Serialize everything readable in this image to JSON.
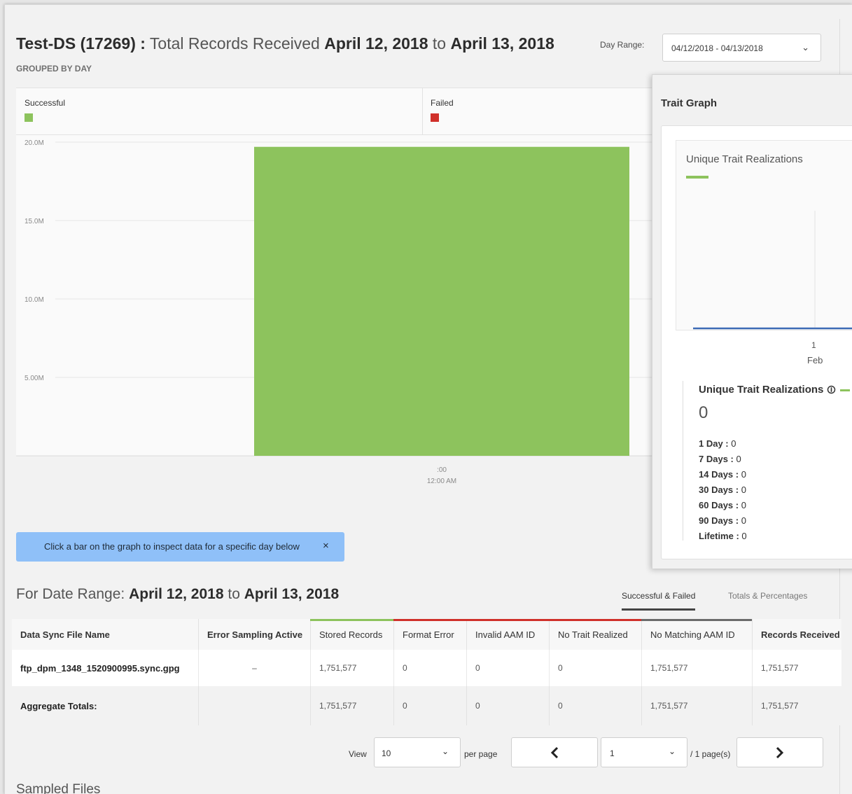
{
  "header": {
    "ds_name": "Test-DS (17269) :",
    "metric": "Total Records Received",
    "date_from": "April 12, 2018",
    "to": "to",
    "date_to": "April 13, 2018",
    "grouped": "GROUPED BY DAY",
    "day_range_label": "Day Range:",
    "day_range_value": "04/12/2018 - 04/13/2018"
  },
  "legend": {
    "successful": "Successful",
    "failed": "Failed"
  },
  "colors": {
    "successful": "#8dc35d",
    "failed": "#d0302a",
    "cta": "#8fc0f8",
    "gray_bar": "#6b6b6b",
    "trait_line": "#3d6bb5"
  },
  "chart_data": {
    "type": "bar",
    "title": "",
    "x_tick_top": ":00",
    "x_tick_bottom": "12:00 AM",
    "y_ticks": [
      "20.0M",
      "15.0M",
      "10.0M",
      "5.00M"
    ],
    "ylim": [
      0,
      20000000
    ],
    "series": [
      {
        "name": "Successful",
        "values": [
          19700000
        ]
      },
      {
        "name": "Failed",
        "values": [
          0
        ]
      }
    ],
    "grid": true
  },
  "cta": {
    "text": "Click a bar on the graph to inspect data for a specific day below",
    "close": "×"
  },
  "range": {
    "prefix": "For Date Range:",
    "from": "April 12, 2018",
    "to": "to",
    "until": "April 13, 2018"
  },
  "tabs": {
    "successful_failed": "Successful & Failed",
    "totals_percentages": "Totals & Percentages"
  },
  "table": {
    "columns": [
      {
        "label": "Data Sync File Name"
      },
      {
        "label": "Error Sampling Active"
      },
      {
        "label": "Stored Records"
      },
      {
        "label": "Format Error"
      },
      {
        "label": "Invalid AAM ID"
      },
      {
        "label": "No Trait Realized"
      },
      {
        "label": "No Matching AAM ID"
      },
      {
        "label": "Records Received"
      }
    ],
    "rows": [
      [
        "ftp_dpm_1348_1520900995.sync.gpg",
        "–",
        "1,751,577",
        "0",
        "0",
        "0",
        "1,751,577",
        "1,751,577"
      ],
      [
        "Aggregate Totals:",
        "",
        "1,751,577",
        "0",
        "0",
        "0",
        "1,751,577",
        "1,751,577"
      ]
    ]
  },
  "pager": {
    "view": "View",
    "per_page_value": "10",
    "per_page": "per page",
    "page_value": "1",
    "page_total": "/ 1 page(s)",
    "prev_icon": "chevron-left-icon",
    "next_icon": "chevron-right-icon"
  },
  "sampled_files": "Sampled Files",
  "trait": {
    "window_title": "Trait Graph",
    "chart_title": "Unique Trait Realizations",
    "x_tick_day": "1",
    "x_tick_month": "Feb",
    "stats_title": "Unique Trait Realizations",
    "total": "0",
    "stats": [
      {
        "k": "1 Day :",
        "v": "0"
      },
      {
        "k": "7 Days :",
        "v": "0"
      },
      {
        "k": "14 Days :",
        "v": "0"
      },
      {
        "k": "30 Days :",
        "v": "0"
      },
      {
        "k": "60 Days :",
        "v": "0"
      },
      {
        "k": "90 Days :",
        "v": "0"
      },
      {
        "k": "Lifetime :",
        "v": "0"
      }
    ]
  }
}
